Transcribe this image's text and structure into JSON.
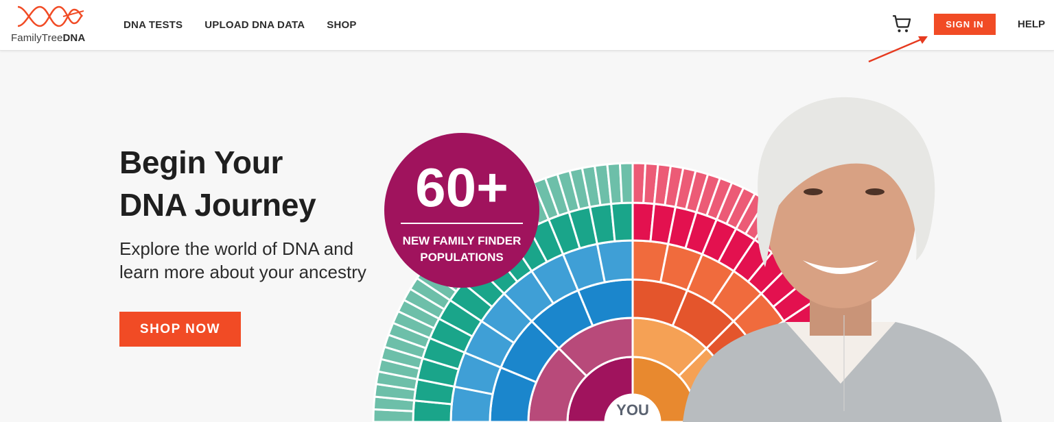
{
  "header": {
    "logo": {
      "prefix": "FamilyTree",
      "suffix": "DNA"
    },
    "nav": [
      {
        "label": "DNA TESTS"
      },
      {
        "label": "UPLOAD DNA DATA"
      },
      {
        "label": "SHOP"
      }
    ],
    "cart_icon": "shopping-cart-icon",
    "sign_in_label": "SIGN IN",
    "help_label": "HELP"
  },
  "hero": {
    "title_lines": [
      "Begin Your",
      "DNA Journey"
    ],
    "subtitle_lines": [
      "Explore the world of DNA and",
      "learn more about your ancestry"
    ],
    "cta_label": "SHOP NOW"
  },
  "badge": {
    "number": "60+",
    "lines": [
      "NEW FAMILY FINDER",
      "POPULATIONS"
    ]
  },
  "fan": {
    "center_label": "YOU"
  },
  "colors": {
    "accent": "#f14b25",
    "badge": "#a0135d",
    "teal": "#1aa58a",
    "blue": "#1b86cc",
    "magenta": "#d81b60",
    "orange": "#f06b3d"
  }
}
